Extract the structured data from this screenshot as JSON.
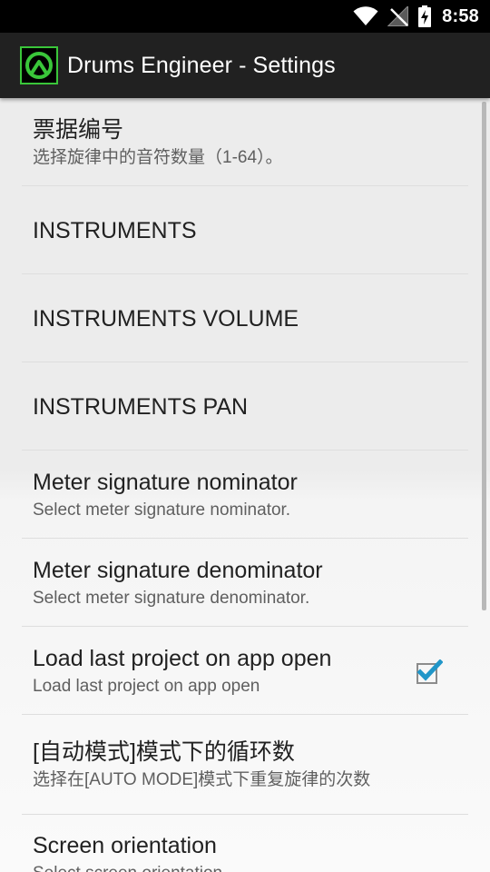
{
  "status_bar": {
    "time": "8:58",
    "icons": [
      "wifi-icon",
      "no-signal-icon",
      "battery-charging-icon"
    ]
  },
  "app_bar": {
    "logo_icon": "drums-engineer-logo-icon",
    "title": "Drums Engineer - Settings",
    "background": "#212121",
    "logo_accent": "#3ac63a"
  },
  "preferences": [
    {
      "title": "票据编号",
      "summary": "选择旋律中的音符数量（1-64）。"
    },
    {
      "title": "INSTRUMENTS"
    },
    {
      "title": "INSTRUMENTS VOLUME"
    },
    {
      "title": "INSTRUMENTS PAN"
    },
    {
      "title": "Meter signature nominator",
      "summary": "Select meter signature nominator."
    },
    {
      "title": "Meter signature denominator",
      "summary": "Select meter signature denominator."
    },
    {
      "title": "Load last project on app open",
      "summary": "Load last project on app open",
      "checked": true
    },
    {
      "title": "[自动模式]模式下的循环数",
      "summary": "选择在[AUTO MODE]模式下重复旋律的次数"
    },
    {
      "title": "Screen orientation",
      "summary": "Select screen orientation"
    }
  ],
  "colors": {
    "checkbox_accent": "#2196c8",
    "divider": "#dedede"
  }
}
